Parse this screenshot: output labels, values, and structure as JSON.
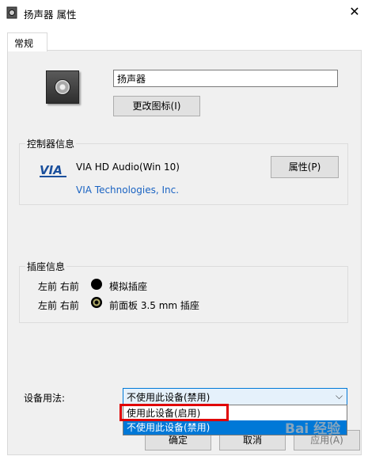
{
  "window": {
    "title": "扬声器 属性",
    "close_glyph": "✕"
  },
  "tabs": [
    {
      "label": "常规",
      "active": true
    }
  ],
  "device": {
    "name_value": "扬声器",
    "change_icon_label": "更改图标(I)"
  },
  "controller": {
    "group_label": "控制器信息",
    "logo_text": "VIA",
    "device_name": "VIA HD Audio(Win 10)",
    "vendor": "VIA Technologies, Inc.",
    "properties_label": "属性(P)"
  },
  "jacks": {
    "group_label": "插座信息",
    "rows": [
      {
        "position": "左前 右前",
        "icon": "jack-empty-icon",
        "name": "模拟插座"
      },
      {
        "position": "左前 右前",
        "icon": "jack-plug-icon",
        "name": "前面板 3.5 mm 插座"
      }
    ]
  },
  "usage": {
    "label": "设备用法:",
    "selected": "不使用此设备(禁用)",
    "options": [
      "使用此设备(启用)",
      "不使用此设备(禁用)"
    ],
    "highlighted_index": 1,
    "annotated_index": 0
  },
  "footer": {
    "ok_label": "确定",
    "cancel_label": "取消",
    "apply_label": "应用(A)"
  },
  "watermark": "Bai 经验",
  "colors": {
    "accent": "#0078d7",
    "annotation": "#e00000",
    "link": "#1a63c2"
  }
}
